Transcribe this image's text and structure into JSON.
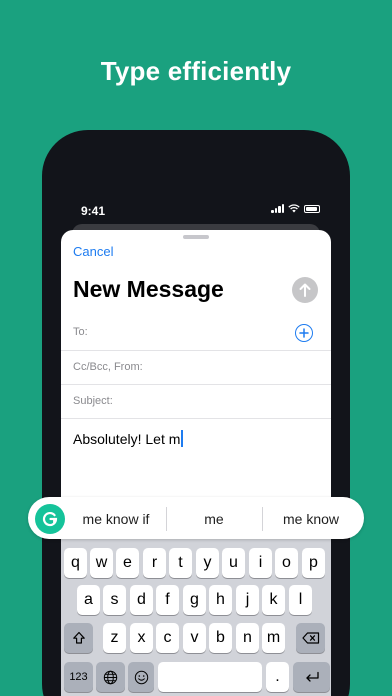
{
  "headline": "Type efficiently",
  "status_bar": {
    "time": "9:41"
  },
  "compose": {
    "cancel_label": "Cancel",
    "title": "New Message",
    "to_label": "To:",
    "ccbcc_label": "Cc/Bcc, From:",
    "subject_label": "Subject:",
    "body_text": "Absolutely! Let m"
  },
  "suggestions": [
    "me know if",
    "me",
    "me know"
  ],
  "keyboard": {
    "row1": [
      "q",
      "w",
      "e",
      "r",
      "t",
      "y",
      "u",
      "i",
      "o",
      "p"
    ],
    "row2": [
      "a",
      "s",
      "d",
      "f",
      "g",
      "h",
      "j",
      "k",
      "l"
    ],
    "row3": [
      "z",
      "x",
      "c",
      "v",
      "b",
      "n",
      "m"
    ],
    "numbers_label": "123",
    "period_label": "."
  },
  "colors": {
    "background": "#1aa17f",
    "accent_blue": "#1e7cf0",
    "grammarly_green": "#15c39a"
  },
  "icons": [
    "signal-icon",
    "wifi-icon",
    "battery-icon",
    "send-arrow-icon",
    "add-contact-icon",
    "grammarly-logo-icon",
    "shift-icon",
    "backspace-icon",
    "globe-icon",
    "emoji-icon",
    "return-icon"
  ]
}
